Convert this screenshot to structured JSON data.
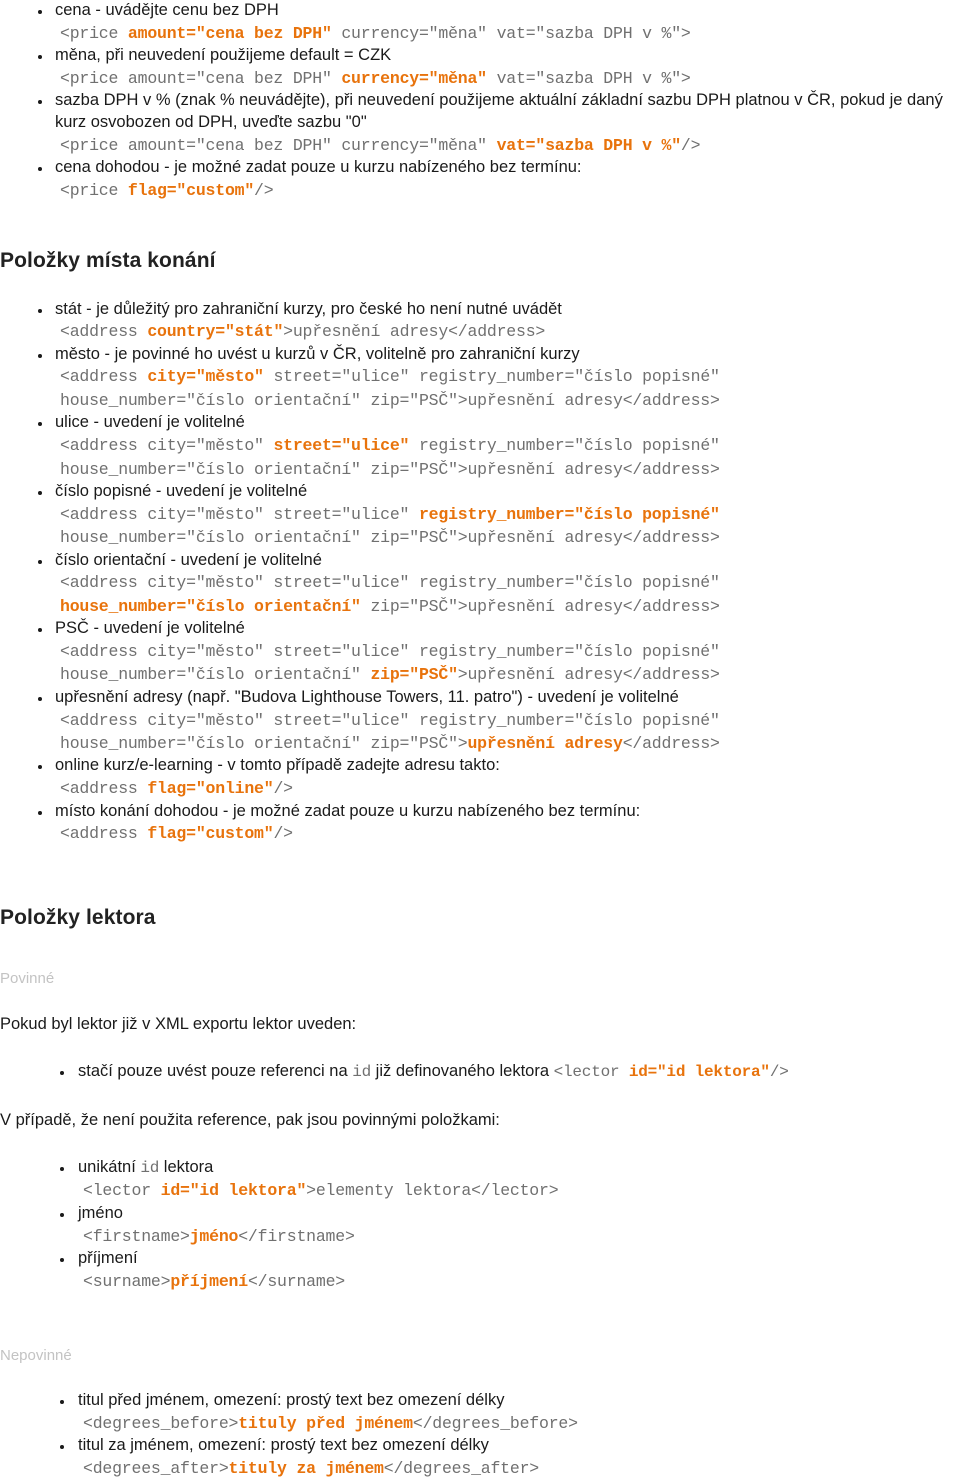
{
  "colors": {
    "highlight": "#e8730c",
    "code": "#707070",
    "text": "#1a1a1a",
    "muted_label": "#c3c3c3"
  },
  "price_section": {
    "items": [
      {
        "label": "cena - uvádějte cenu bez DPH",
        "code_lines": [
          [
            {
              "t": "<price ",
              "h": false
            },
            {
              "t": "amount=\"cena bez DPH\"",
              "h": true
            },
            {
              "t": " currency=\"měna\" vat=\"sazba DPH v %\">",
              "h": false
            }
          ]
        ]
      },
      {
        "label": "měna, při neuvedení použijeme default = CZK",
        "code_lines": [
          [
            {
              "t": "<price amount=\"cena bez DPH\" ",
              "h": false
            },
            {
              "t": "currency=\"měna\"",
              "h": true
            },
            {
              "t": " vat=\"sazba DPH v %\">",
              "h": false
            }
          ]
        ]
      },
      {
        "label": "sazba DPH v % (znak % neuvádějte), při neuvedení použijeme aktuální základní sazbu DPH platnou v ČR, pokud je daný kurz osvobozen od DPH, uveďte sazbu \"0\"",
        "code_lines": [
          [
            {
              "t": "<price amount=\"cena bez DPH\" currency=\"měna\" ",
              "h": false
            },
            {
              "t": "vat=\"sazba DPH v %\"",
              "h": true
            },
            {
              "t": "/>",
              "h": false
            }
          ]
        ]
      },
      {
        "label": "cena dohodou - je možné zadat pouze u kurzu nabízeného bez termínu:",
        "code_lines": [
          [
            {
              "t": "<price ",
              "h": false
            },
            {
              "t": "flag=\"custom\"",
              "h": true
            },
            {
              "t": "/>",
              "h": false
            }
          ]
        ]
      }
    ]
  },
  "venue_section": {
    "heading": "Položky místa konání",
    "items": [
      {
        "label": "stát - je důležitý pro zahraniční kurzy, pro české ho není nutné uvádět",
        "code_lines": [
          [
            {
              "t": "<address ",
              "h": false
            },
            {
              "t": "country=\"stát\"",
              "h": true
            },
            {
              "t": ">upřesnění adresy</address>",
              "h": false
            }
          ]
        ]
      },
      {
        "label": "město - je povinné ho uvést u kurzů v ČR, volitelně pro zahraniční kurzy",
        "code_lines": [
          [
            {
              "t": "<address ",
              "h": false
            },
            {
              "t": "city=\"město\"",
              "h": true
            },
            {
              "t": " street=\"ulice\" registry_number=\"číslo popisné\"",
              "h": false
            }
          ],
          [
            {
              "t": "house_number=\"číslo orientační\" zip=\"PSČ\">upřesnění adresy</address>",
              "h": false
            }
          ]
        ]
      },
      {
        "label": "ulice - uvedení je volitelné",
        "code_lines": [
          [
            {
              "t": "<address city=\"město\" ",
              "h": false
            },
            {
              "t": "street=\"ulice\"",
              "h": true
            },
            {
              "t": " registry_number=\"číslo popisné\"",
              "h": false
            }
          ],
          [
            {
              "t": "house_number=\"číslo orientační\" zip=\"PSČ\">upřesnění adresy</address>",
              "h": false
            }
          ]
        ]
      },
      {
        "label": "číslo popisné - uvedení je volitelné",
        "code_lines": [
          [
            {
              "t": "<address city=\"město\" street=\"ulice\" ",
              "h": false
            },
            {
              "t": "registry_number=\"číslo popisné\"",
              "h": true
            }
          ],
          [
            {
              "t": "house_number=\"číslo orientační\" zip=\"PSČ\">upřesnění adresy</address>",
              "h": false
            }
          ]
        ]
      },
      {
        "label": "číslo orientační - uvedení je volitelné",
        "code_lines": [
          [
            {
              "t": "<address city=\"město\" street=\"ulice\" registry_number=\"číslo popisné\"",
              "h": false
            }
          ],
          [
            {
              "t": "house_number=\"číslo orientační\"",
              "h": true
            },
            {
              "t": " zip=\"PSČ\">upřesnění adresy</address>",
              "h": false
            }
          ]
        ]
      },
      {
        "label": "PSČ - uvedení je volitelné",
        "code_lines": [
          [
            {
              "t": "<address city=\"město\" street=\"ulice\" registry_number=\"číslo popisné\"",
              "h": false
            }
          ],
          [
            {
              "t": "house_number=\"číslo orientační\" ",
              "h": false
            },
            {
              "t": "zip=\"PSČ\"",
              "h": true
            },
            {
              "t": ">upřesnění adresy</address>",
              "h": false
            }
          ]
        ]
      },
      {
        "label": "upřesnění adresy (např. \"Budova Lighthouse Towers, 11. patro\") - uvedení je volitelné",
        "code_lines": [
          [
            {
              "t": "<address city=\"město\" street=\"ulice\" registry_number=\"číslo popisné\"",
              "h": false
            }
          ],
          [
            {
              "t": "house_number=\"číslo orientační\" zip=\"PSČ\">",
              "h": false
            },
            {
              "t": "upřesnění adresy",
              "h": true
            },
            {
              "t": "</address>",
              "h": false
            }
          ]
        ]
      },
      {
        "label": "online kurz/e-learning - v tomto případě zadejte adresu takto:",
        "code_lines": [
          [
            {
              "t": "<address ",
              "h": false
            },
            {
              "t": "flag=\"online\"",
              "h": true
            },
            {
              "t": "/>",
              "h": false
            }
          ]
        ]
      },
      {
        "label": "místo konání dohodou - je možné zadat pouze u kurzu nabízeného bez termínu:",
        "code_lines": [
          [
            {
              "t": "<address ",
              "h": false
            },
            {
              "t": "flag=\"custom\"",
              "h": true
            },
            {
              "t": "/>",
              "h": false
            }
          ]
        ]
      }
    ]
  },
  "lecturer_section": {
    "heading": "Položky lektora",
    "required_label": "Povinné",
    "optional_label": "Nepovinné",
    "intro_para_1": "Pokud byl lektor již v XML exportu lektor uveden:",
    "reference_item": {
      "prefix": "stačí pouze uvést pouze referenci na ",
      "code_mid": "id",
      "middle": " již definovaného lektora ",
      "code_parts": [
        {
          "t": "<lector ",
          "h": false
        },
        {
          "t": "id=\"id lektora\"",
          "h": true
        },
        {
          "t": "/>",
          "h": false
        }
      ]
    },
    "intro_para_2": "V případě, že není použita reference, pak jsou povinnými položkami:",
    "required_items": [
      {
        "label_prefix": "unikátní ",
        "label_code": "id",
        "label_suffix": " lektora",
        "code_lines": [
          [
            {
              "t": "<lector ",
              "h": false
            },
            {
              "t": "id=\"id lektora\"",
              "h": true
            },
            {
              "t": ">elementy lektora</lector>",
              "h": false
            }
          ]
        ]
      },
      {
        "label": "jméno",
        "code_lines": [
          [
            {
              "t": "<firstname>",
              "h": false
            },
            {
              "t": "jméno",
              "h": true
            },
            {
              "t": "</firstname>",
              "h": false
            }
          ]
        ]
      },
      {
        "label": "příjmení",
        "code_lines": [
          [
            {
              "t": "<surname>",
              "h": false
            },
            {
              "t": "příjmení",
              "h": true
            },
            {
              "t": "</surname>",
              "h": false
            }
          ]
        ]
      }
    ],
    "optional_items": [
      {
        "label": "titul před jménem, omezení: prostý text bez omezení délky",
        "code_lines": [
          [
            {
              "t": "<degrees_before>",
              "h": false
            },
            {
              "t": "tituly před jménem",
              "h": true
            },
            {
              "t": "</degrees_before>",
              "h": false
            }
          ]
        ]
      },
      {
        "label": "titul za jménem, omezení: prostý text bez omezení délky",
        "code_lines": [
          [
            {
              "t": "<degrees_after>",
              "h": false
            },
            {
              "t": "tituly za jménem",
              "h": true
            },
            {
              "t": "</degrees_after>",
              "h": false
            }
          ]
        ]
      }
    ]
  }
}
